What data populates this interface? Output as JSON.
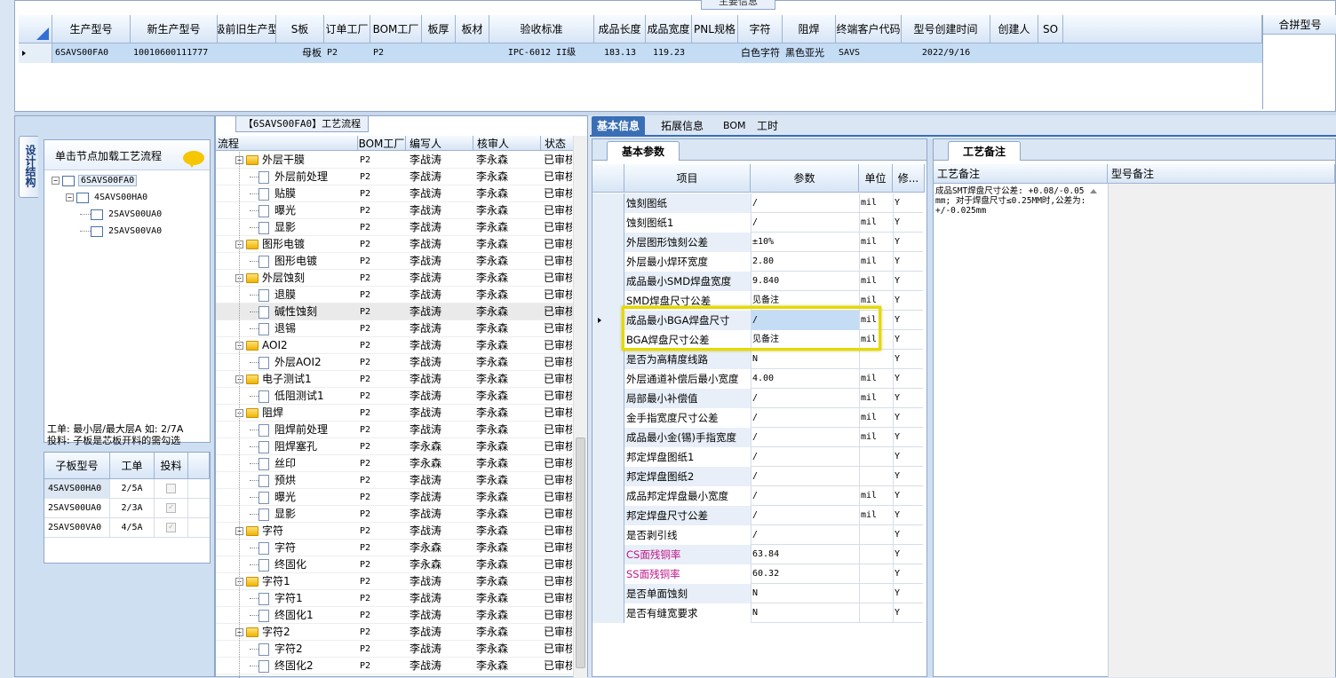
{
  "top": {
    "panel_title": "主要信息",
    "columns": [
      "生产型号",
      "新生产型号",
      "升级前旧生产型号",
      "S板",
      "订单工厂",
      "BOM工厂",
      "板厚",
      "板材",
      "验收标准",
      "成品长度",
      "成品宽度",
      "PNL规格",
      "字符",
      "阻焊",
      "终端客户代码",
      "型号创建时间",
      "创建人",
      "SO"
    ],
    "row": {
      "a": "6SAVS00FA0",
      "b": "10010600111777",
      "c": "",
      "d": "母板",
      "e": "P2",
      "f": "P2",
      "g": "",
      "h": "",
      "i": "IPC-6012 II级",
      "j": "183.13",
      "k": "119.23",
      "l": "",
      "m": "白色字符",
      "n": "黑色亚光",
      "o": "SAVS",
      "p": "2022/9/16",
      "q": "",
      "r": ""
    },
    "merge_header": "合拼型号"
  },
  "left": {
    "vtab": "设计结构",
    "hint": "单击节点加载工艺流程",
    "tree": [
      "6SAVS00FA0",
      "4SAVS00HA0",
      "2SAVS00UA0",
      "2SAVS00VA0"
    ],
    "note1": "工单: 最小层/最大层A 如: 2/7A",
    "note2": "投料: 子板是芯板开料的需勾选",
    "sub_cols": [
      "子板型号",
      "工单",
      "投料"
    ],
    "sub_rows": [
      {
        "model": "4SAVS00HA0",
        "order": "2/5A"
      },
      {
        "model": "2SAVS00UA0",
        "order": "2/3A"
      },
      {
        "model": "2SAVS00VA0",
        "order": "4/5A"
      }
    ]
  },
  "flow": {
    "title": "【6SAVS00FA0】工艺流程",
    "cols": [
      "流程",
      "BOM工厂",
      "编写人",
      "核审人",
      "状态"
    ],
    "rows": [
      {
        "name": "外层干膜",
        "lvl": 0,
        "f": "P2",
        "w": "李战涛",
        "r": "李永森",
        "s": "已审核"
      },
      {
        "name": "外层前处理",
        "lvl": 1,
        "f": "P2",
        "w": "李战涛",
        "r": "李永森",
        "s": "已审核"
      },
      {
        "name": "贴膜",
        "lvl": 1,
        "f": "P2",
        "w": "李战涛",
        "r": "李永森",
        "s": "已审核"
      },
      {
        "name": "曝光",
        "lvl": 1,
        "f": "P2",
        "w": "李战涛",
        "r": "李永森",
        "s": "已审核"
      },
      {
        "name": "显影",
        "lvl": 1,
        "f": "P2",
        "w": "李战涛",
        "r": "李永森",
        "s": "已审核"
      },
      {
        "name": "图形电镀",
        "lvl": 0,
        "f": "P2",
        "w": "李战涛",
        "r": "李永森",
        "s": "已审核"
      },
      {
        "name": "图形电镀",
        "lvl": 1,
        "f": "P2",
        "w": "李战涛",
        "r": "李永森",
        "s": "已审核"
      },
      {
        "name": "外层蚀刻",
        "lvl": 0,
        "f": "P2",
        "w": "李战涛",
        "r": "李永森",
        "s": "已审核"
      },
      {
        "name": "退膜",
        "lvl": 1,
        "f": "P2",
        "w": "李战涛",
        "r": "李永森",
        "s": "已审核"
      },
      {
        "name": "碱性蚀刻",
        "lvl": 1,
        "f": "P2",
        "w": "李战涛",
        "r": "李永森",
        "s": "已审核"
      },
      {
        "name": "退锡",
        "lvl": 1,
        "f": "P2",
        "w": "李战涛",
        "r": "李永森",
        "s": "已审核"
      },
      {
        "name": "AOI2",
        "lvl": 0,
        "f": "P2",
        "w": "李战涛",
        "r": "李永森",
        "s": "已审核"
      },
      {
        "name": "外层AOI2",
        "lvl": 1,
        "f": "P2",
        "w": "李战涛",
        "r": "李永森",
        "s": "已审核"
      },
      {
        "name": "电子测试1",
        "lvl": 0,
        "f": "P2",
        "w": "李战涛",
        "r": "李永森",
        "s": "已审核"
      },
      {
        "name": "低阻测试1",
        "lvl": 1,
        "f": "P2",
        "w": "李战涛",
        "r": "李永森",
        "s": "已审核"
      },
      {
        "name": "阻焊",
        "lvl": 0,
        "f": "P2",
        "w": "李战涛",
        "r": "李永森",
        "s": "已审核"
      },
      {
        "name": "阻焊前处理",
        "lvl": 1,
        "f": "P2",
        "w": "李战涛",
        "r": "李永森",
        "s": "已审核"
      },
      {
        "name": "阻焊塞孔",
        "lvl": 1,
        "f": "P2",
        "w": "李永森",
        "r": "李永森",
        "s": "已审核"
      },
      {
        "name": "丝印",
        "lvl": 1,
        "f": "P2",
        "w": "李永森",
        "r": "李永森",
        "s": "已审核"
      },
      {
        "name": "预烘",
        "lvl": 1,
        "f": "P2",
        "w": "李战涛",
        "r": "李永森",
        "s": "已审核"
      },
      {
        "name": "曝光",
        "lvl": 1,
        "f": "P2",
        "w": "李战涛",
        "r": "李永森",
        "s": "已审核"
      },
      {
        "name": "显影",
        "lvl": 1,
        "f": "P2",
        "w": "李战涛",
        "r": "李永森",
        "s": "已审核"
      },
      {
        "name": "字符",
        "lvl": 0,
        "f": "P2",
        "w": "李战涛",
        "r": "李永森",
        "s": "已审核"
      },
      {
        "name": "字符",
        "lvl": 1,
        "f": "P2",
        "w": "李永森",
        "r": "李永森",
        "s": "已审核"
      },
      {
        "name": "终固化",
        "lvl": 1,
        "f": "P2",
        "w": "李永森",
        "r": "李永森",
        "s": "已审核"
      },
      {
        "name": "字符1",
        "lvl": 0,
        "f": "P2",
        "w": "李战涛",
        "r": "李永森",
        "s": "已审核"
      },
      {
        "name": "字符1",
        "lvl": 1,
        "f": "P2",
        "w": "李战涛",
        "r": "李永森",
        "s": "已审核"
      },
      {
        "name": "终固化1",
        "lvl": 1,
        "f": "P2",
        "w": "李战涛",
        "r": "李永森",
        "s": "已审核"
      },
      {
        "name": "字符2",
        "lvl": 0,
        "f": "P2",
        "w": "李战涛",
        "r": "李永森",
        "s": "已审核"
      },
      {
        "name": "字符2",
        "lvl": 1,
        "f": "P2",
        "w": "李战涛",
        "r": "李永森",
        "s": "已审核"
      },
      {
        "name": "终固化2",
        "lvl": 1,
        "f": "P2",
        "w": "李战涛",
        "r": "李永森",
        "s": "已审核"
      }
    ]
  },
  "tabs": [
    "基本信息",
    "拓展信息",
    "BOM",
    "工时"
  ],
  "params": {
    "title": "基本参数",
    "cols": [
      "项目",
      "参数",
      "单位",
      "修..."
    ],
    "rows": [
      {
        "item": "蚀刻图纸",
        "val": "/",
        "unit": "mil",
        "mod": "Y",
        "shade": true
      },
      {
        "item": "蚀刻图纸1",
        "val": "/",
        "unit": "mil",
        "mod": "Y",
        "shade": false
      },
      {
        "item": "外层图形蚀刻公差",
        "val": "±10%",
        "unit": "mil",
        "mod": "Y",
        "shade": true
      },
      {
        "item": "外层最小焊环宽度",
        "val": "2.80",
        "unit": "mil",
        "mod": "Y",
        "shade": false
      },
      {
        "item": "成品最小SMD焊盘宽度",
        "val": "9.840",
        "unit": "mil",
        "mod": "Y",
        "shade": true
      },
      {
        "item": "SMD焊盘尺寸公差",
        "val": "见备注",
        "unit": "mil",
        "mod": "Y",
        "shade": false
      },
      {
        "item": "成品最小BGA焊盘尺寸",
        "val": "/",
        "unit": "mil",
        "mod": "Y",
        "shade": true
      },
      {
        "item": "BGA焊盘尺寸公差",
        "val": "见备注",
        "unit": "mil",
        "mod": "Y",
        "shade": false
      },
      {
        "item": "是否为高精度线路",
        "val": "N",
        "unit": "",
        "mod": "Y",
        "shade": true
      },
      {
        "item": "外层通道补偿后最小宽度",
        "val": "4.00",
        "unit": "mil",
        "mod": "Y",
        "shade": false
      },
      {
        "item": "局部最小补偿值",
        "val": "/",
        "unit": "mil",
        "mod": "Y",
        "shade": true
      },
      {
        "item": "金手指宽度尺寸公差",
        "val": "/",
        "unit": "mil",
        "mod": "Y",
        "shade": false
      },
      {
        "item": "成品最小金(锡)手指宽度",
        "val": "/",
        "unit": "mil",
        "mod": "Y",
        "shade": true
      },
      {
        "item": "邦定焊盘图纸1",
        "val": "/",
        "unit": "",
        "mod": "Y",
        "shade": false
      },
      {
        "item": "邦定焊盘图纸2",
        "val": "/",
        "unit": "",
        "mod": "Y",
        "shade": true
      },
      {
        "item": "成品邦定焊盘最小宽度",
        "val": "/",
        "unit": "mil",
        "mod": "Y",
        "shade": false
      },
      {
        "item": "邦定焊盘尺寸公差",
        "val": "/",
        "unit": "mil",
        "mod": "Y",
        "shade": true
      },
      {
        "item": "是否剥引线",
        "val": "/",
        "unit": "",
        "mod": "Y",
        "shade": false
      },
      {
        "item": "CS面残铜率",
        "val": "63.84",
        "unit": "",
        "mod": "Y",
        "shade": true,
        "pink": true
      },
      {
        "item": "SS面残铜率",
        "val": "60.32",
        "unit": "",
        "mod": "Y",
        "shade": false,
        "pink": true
      },
      {
        "item": "是否单面蚀刻",
        "val": "N",
        "unit": "",
        "mod": "Y",
        "shade": true
      },
      {
        "item": "是否有缝宽要求",
        "val": "N",
        "unit": "",
        "mod": "Y",
        "shade": false
      }
    ]
  },
  "notes": {
    "tab": "工艺备注",
    "col1": "工艺备注",
    "col2": "型号备注",
    "text": "成品SMT焊盘尺寸公差: +0.08/-0.05mm; 对于焊盘尺寸≤0.25MM时,公差为: +/-0.025mm"
  },
  "colors": {
    "accent": "#3a6fb5",
    "selected_row": "#c5dcf5",
    "highlight_box": "#e6d800",
    "pink_text": "#c0158a"
  }
}
